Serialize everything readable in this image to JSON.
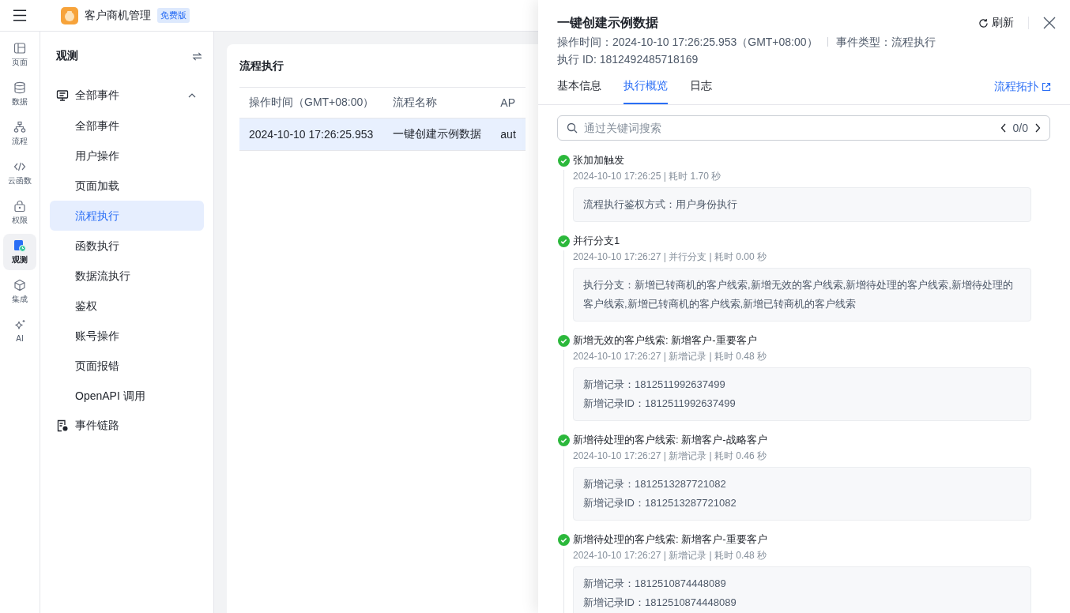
{
  "header": {
    "app_name": "客户商机管理",
    "plan_badge": "免费版"
  },
  "rail": [
    {
      "label": "页面",
      "selected": false
    },
    {
      "label": "数据",
      "selected": false
    },
    {
      "label": "流程",
      "selected": false
    },
    {
      "label": "云函数",
      "selected": false
    },
    {
      "label": "权限",
      "selected": false
    },
    {
      "label": "观测",
      "selected": true
    },
    {
      "label": "集成",
      "selected": false
    },
    {
      "label": "AI",
      "selected": false
    }
  ],
  "sidebar": {
    "title": "观测",
    "items": [
      {
        "label": "全部事件",
        "expanded": true,
        "children": [
          {
            "label": "全部事件",
            "selected": false
          },
          {
            "label": "用户操作",
            "selected": false
          },
          {
            "label": "页面加载",
            "selected": false
          },
          {
            "label": "流程执行",
            "selected": true
          },
          {
            "label": "函数执行",
            "selected": false
          },
          {
            "label": "数据流执行",
            "selected": false
          },
          {
            "label": "鉴权",
            "selected": false
          },
          {
            "label": "账号操作",
            "selected": false
          },
          {
            "label": "页面报错",
            "selected": false
          },
          {
            "label": "OpenAPI 调用",
            "selected": false
          }
        ]
      },
      {
        "label": "事件链路"
      }
    ]
  },
  "card": {
    "title": "流程执行",
    "table": {
      "columns": [
        "操作时间（GMT+08:00）",
        "流程名称",
        "AP"
      ],
      "rows": [
        {
          "cells": [
            "2024-10-10 17:26:25.953",
            "一键创建示例数据",
            "aut"
          ],
          "selected": true
        }
      ]
    }
  },
  "drawer": {
    "title": "一键创建示例数据",
    "meta": [
      "操作时间：2024-10-10 17:26:25.953（GMT+08:00）",
      "事件类型：流程执行"
    ],
    "exec_id": "执行 ID: 1812492485718169",
    "refresh": "刷新",
    "tabs": [
      {
        "label": "基本信息",
        "selected": false
      },
      {
        "label": "执行概览",
        "selected": true
      },
      {
        "label": "日志",
        "selected": false
      }
    ],
    "topology_link": "流程拓扑",
    "search": {
      "placeholder": "通过关键词搜索",
      "counter": "0/0"
    },
    "timeline": [
      {
        "title": "张加加触发",
        "meta": "2024-10-10 17:26:25 | 耗时 1.70 秒",
        "details": [
          "流程执行鉴权方式：用户身份执行"
        ]
      },
      {
        "title": "并行分支1",
        "meta": "2024-10-10 17:26:27 | 并行分支 | 耗时 0.00 秒",
        "details": [
          "执行分支：新增已转商机的客户线索,新增无效的客户线索,新增待处理的客户线索,新增待处理的客户线索,新增已转商机的客户线索,新增已转商机的客户线索"
        ]
      },
      {
        "title": "新增无效的客户线索: 新增客户-重要客户",
        "meta": "2024-10-10 17:26:27 | 新增记录 | 耗时 0.48 秒",
        "details": [
          "新增记录：1812511992637499",
          "新增记录ID：1812511992637499"
        ]
      },
      {
        "title": "新增待处理的客户线索: 新增客户-战略客户",
        "meta": "2024-10-10 17:26:27 | 新增记录 | 耗时 0.46 秒",
        "details": [
          "新增记录：1812513287721082",
          "新增记录ID：1812513287721082"
        ]
      },
      {
        "title": "新增待处理的客户线索: 新增客户-重要客户",
        "meta": "2024-10-10 17:26:27 | 新增记录 | 耗时 0.48 秒",
        "details": [
          "新增记录：1812510874448089",
          "新增记录ID：1812510874448089"
        ]
      }
    ]
  }
}
